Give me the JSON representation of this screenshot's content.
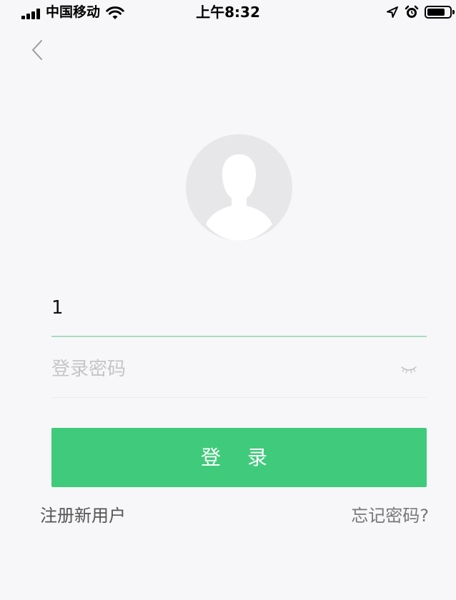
{
  "status_bar": {
    "carrier": "中国移动",
    "time": "上午8:32",
    "icons": [
      "signal-icon",
      "wifi-icon",
      "location-icon",
      "alarm-icon",
      "battery-icon"
    ]
  },
  "nav": {
    "back_icon": "chevron-left-icon"
  },
  "avatar": {
    "icon": "default-user-avatar-icon"
  },
  "login_form": {
    "username_value": "1",
    "password_placeholder": "登录密码",
    "password_toggle_icon": "eye-closed-icon",
    "submit_label": "登 录",
    "register_label": "注册新用户",
    "forgot_label": "忘记密码?"
  },
  "colors": {
    "primary": "#3fcb7b",
    "active_underline": "#a9dcc0",
    "placeholder": "#c5c5c8",
    "avatar_bg": "#e7e7ea"
  }
}
